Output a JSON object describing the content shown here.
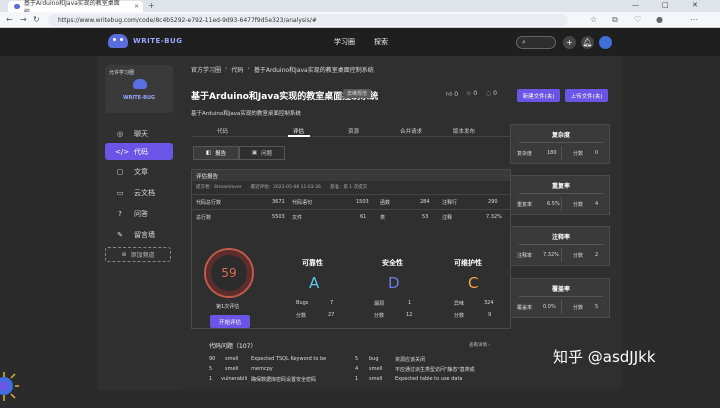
{
  "browser": {
    "tab_title": "基于Arduino和Java实现的教室桌面控...",
    "url": "https://www.writebug.com/code/8c4b5292-e792-11ed-9d93-6477f9d5e323/analysis/#",
    "tab_close": "×",
    "tab_add": "+",
    "win_min": "—",
    "win_max": "□",
    "win_close": "✕"
  },
  "header": {
    "logo_text": "WRITE-BUG",
    "nav": [
      "学习圈",
      "探索"
    ],
    "add_glyph": "+"
  },
  "sidebar": {
    "cover_caption": "允许学习圈",
    "cover_brand": "WRITE-BUG",
    "items": [
      {
        "icon": "◎",
        "label": "聊天"
      },
      {
        "icon": "</>",
        "label": "代码"
      },
      {
        "icon": "▢",
        "label": "文章"
      },
      {
        "icon": "▭",
        "label": "云文档"
      },
      {
        "icon": "?",
        "label": "问答"
      },
      {
        "icon": "✎",
        "label": "留言墙"
      }
    ],
    "add_space": "添加频道",
    "add_icon": "⊕"
  },
  "main": {
    "breadcrumb": [
      "官方学习圈",
      "代码",
      "基于Arduino和Java实现的教室桌面控制系统"
    ],
    "title": "基于Arduino和Java实现的教室桌面控制系统",
    "badge": "去维规范",
    "like_count": "0",
    "star_count": "0",
    "comment_count": "0",
    "new_file_btn": "新建文件(夹)",
    "upload_btn": "上传文件(夹)",
    "subtitle": "基于Arduino和Java实现的教室桌面控制系统",
    "tabs": [
      "代码",
      "评估",
      "资源",
      "合并请求",
      "版本发布"
    ],
    "seg_report": "报告",
    "seg_issues": "问题",
    "report_title": "评估报告",
    "meta": "提交者：Streamlover　　最近评估：2023-05-08 11:03:36　　基准：第 1 次提交",
    "metrics": [
      [
        {
          "k": "代码总行数",
          "v": "3671"
        },
        {
          "k": "代码语句",
          "v": "1503"
        },
        {
          "k": "函数",
          "v": "284"
        },
        {
          "k": "注释行",
          "v": "290"
        }
      ],
      [
        {
          "k": "总行数",
          "v": "5503"
        },
        {
          "k": "文件",
          "v": "61"
        },
        {
          "k": "类",
          "v": "53"
        },
        {
          "k": "注释",
          "v": "7.32%"
        }
      ]
    ],
    "score": "59",
    "eval_label": "第1次评估",
    "eval_btn": "开始评估",
    "grades": [
      {
        "head": "可靠性",
        "grade": "A",
        "color": "#57c7ee",
        "k1": "Bugs",
        "v1": "7",
        "k2": "分数",
        "v2": "27"
      },
      {
        "head": "安全性",
        "grade": "D",
        "color": "#6c7dea",
        "k1": "漏洞",
        "v1": "1",
        "k2": "分数",
        "v2": "12"
      },
      {
        "head": "可维护性",
        "grade": "C",
        "color": "#f2a24b",
        "k1": "异味",
        "v1": "324",
        "k2": "分数",
        "v2": "9"
      }
    ],
    "issues_title": "代码问题（107）",
    "issues_more": "查看详情",
    "issues": [
      {
        "n": "90",
        "type": "smell",
        "desc": "Expected TSQL Keyword to be",
        "n2": "5",
        "type2": "bug",
        "desc2": "资源应该关闭"
      },
      {
        "n": "5",
        "type": "smell",
        "desc": "memcpy",
        "n2": "4",
        "type2": "smell",
        "desc2": "不应通过派生类型访问\"静态\"基类成"
      },
      {
        "n": "1",
        "type": "vulnerabili",
        "desc": "确保数据库密码设置安全密码",
        "n2": "1",
        "type2": "smell",
        "desc2": "Expected table to use data"
      }
    ]
  },
  "right": {
    "cards": [
      {
        "title": "复杂度",
        "k1": "复杂度",
        "v1": "180",
        "k2": "分数",
        "v2": "0"
      },
      {
        "title": "重复率",
        "k1": "重复率",
        "v1": "6.5%",
        "k2": "分数",
        "v2": "4"
      },
      {
        "title": "注释率",
        "k1": "注释率",
        "v1": "7.32%",
        "k2": "分数",
        "v2": "2"
      },
      {
        "title": "覆盖率",
        "k1": "覆盖率",
        "v1": "0.0%",
        "k2": "分数",
        "v2": "5"
      }
    ]
  },
  "watermark": "知乎 @asdJJkk"
}
